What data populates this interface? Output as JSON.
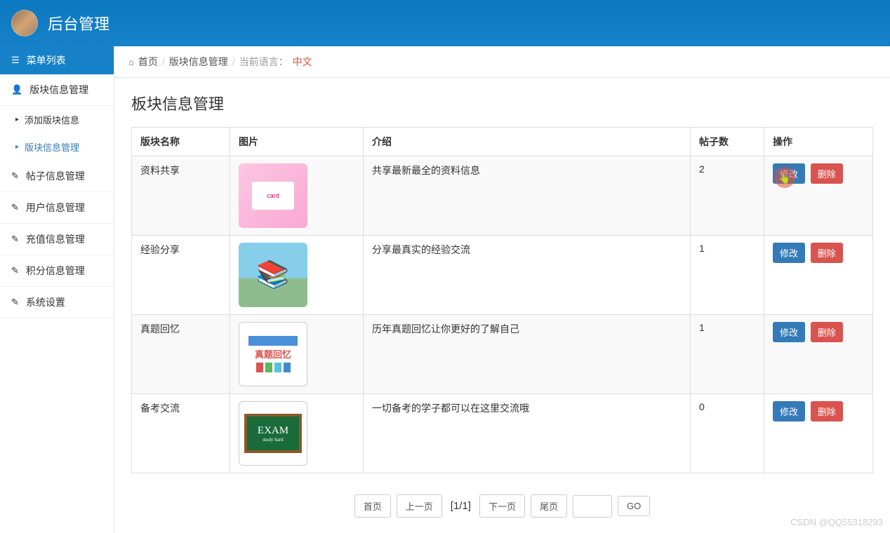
{
  "header": {
    "title": "后台管理"
  },
  "sidebar": {
    "menu_header": "菜单列表",
    "items": [
      {
        "label": "版块信息管理",
        "icon": "user-icon",
        "expanded": true,
        "children": [
          {
            "label": "添加版块信息",
            "active": false
          },
          {
            "label": "版块信息管理",
            "active": true
          }
        ]
      },
      {
        "label": "帖子信息管理",
        "icon": "edit-icon"
      },
      {
        "label": "用户信息管理",
        "icon": "edit-icon"
      },
      {
        "label": "充值信息管理",
        "icon": "edit-icon"
      },
      {
        "label": "积分信息管理",
        "icon": "edit-icon"
      },
      {
        "label": "系统设置",
        "icon": "edit-icon"
      }
    ]
  },
  "breadcrumb": {
    "home": "首页",
    "section": "版块信息管理",
    "lang_label": "当前语言：",
    "lang_value": "中文"
  },
  "page": {
    "title": "板块信息管理"
  },
  "table": {
    "headers": {
      "name": "版块名称",
      "image": "图片",
      "intro": "介绍",
      "count": "帖子数",
      "op": "操作"
    },
    "rows": [
      {
        "name": "资料共享",
        "intro": "共享最新最全的资料信息",
        "count": "2"
      },
      {
        "name": "经验分享",
        "intro": "分享最真实的经验交流",
        "count": "1"
      },
      {
        "name": "真题回忆",
        "intro": "历年真题回忆让你更好的了解自己",
        "count": "1"
      },
      {
        "name": "备考交流",
        "intro": "一切备考的学子都可以在这里交流哦",
        "count": "0"
      }
    ],
    "edit_label": "修改",
    "delete_label": "删除",
    "thumb3_text": "真题回忆",
    "thumb4_text": "EXAM"
  },
  "pagination": {
    "first": "首页",
    "prev": "上一页",
    "info": "[1/1]",
    "next": "下一页",
    "last": "尾页",
    "go": "GO"
  },
  "watermark": "CSDN @QQ55318293"
}
